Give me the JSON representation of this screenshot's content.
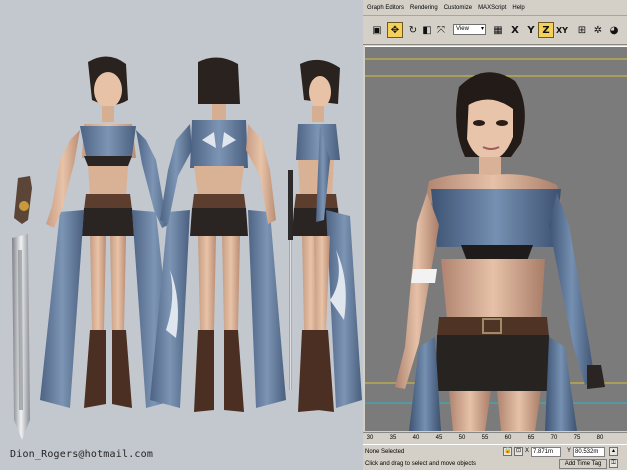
{
  "watermark": "Dion_Rogers@hotmail.com",
  "max": {
    "menu": [
      "Graph Editors",
      "Rendering",
      "Customize",
      "MAXScript",
      "Help"
    ],
    "ref_coord_system": "View",
    "axis_buttons": [
      "X",
      "Y",
      "Z",
      "XY"
    ],
    "active_axis": "Z",
    "timeline_ticks": [
      "30",
      "35",
      "40",
      "45",
      "50",
      "55",
      "60",
      "65",
      "70",
      "75",
      "80"
    ],
    "selection_status": "None Selected",
    "prompt": "Click and drag to select and move objects",
    "coords": {
      "x_label": "X",
      "x_value": "7.871m",
      "y_label": "Y",
      "y_value": "80.532m"
    },
    "add_time_tag": "Add Time Tag"
  },
  "colors": {
    "left_bg": "#c3c8ce",
    "viewport_bg": "#7b7b7b",
    "max_chrome": "#d4d0c8",
    "active_button": "#f5d15b",
    "guide_yellow": "#d9c23a",
    "guide_cyan": "#2fb7c4"
  }
}
